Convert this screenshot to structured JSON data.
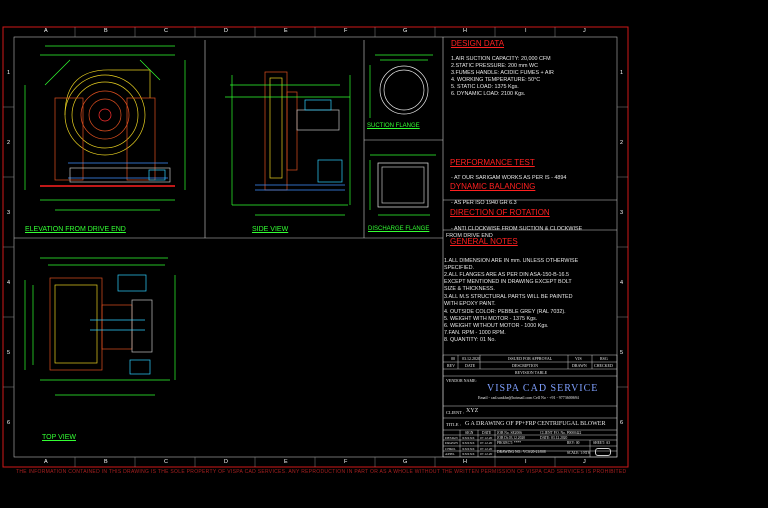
{
  "grid": {
    "columns": [
      "A",
      "B",
      "C",
      "D",
      "E",
      "F",
      "G",
      "H",
      "I",
      "J"
    ],
    "rows": [
      "1",
      "2",
      "3",
      "4",
      "5",
      "6"
    ]
  },
  "views": {
    "elevation_label": "ELEVATION FROM DRIVE END",
    "side_label": "SIDE VIEW",
    "suction_label": "SUCTION FLANGE",
    "discharge_label": "DISCHARGE FLANGE",
    "top_label": "TOP VIEW"
  },
  "design_data": {
    "heading": "DESIGN DATA",
    "lines": [
      "1.AIR SUCTION CAPACITY: 20,000 CFM",
      "2.STATIC PRESSURE: 200 mm WC",
      "3.FUMES HANDLE: ACIDIC FUMES + AIR",
      "4.   WORKING TEMPERATURE: 50°C",
      "5.   STATIC LOAD: 1375 Kgs.",
      "6.   DYNAMIC LOAD: 2100 Kgs."
    ]
  },
  "performance": {
    "heading": "PERFORMANCE TEST",
    "text": "- AT OUR SARIGAM WORKS AS PER IS - 4894"
  },
  "balancing": {
    "heading": "DYNAMIC BALANCING",
    "text": "- AS PER ISO 1940 GR 6.3"
  },
  "rotation": {
    "heading": "DIRECTION OF ROTATION",
    "text1": "- ANTI CLOCKWISE FROM SUCTION  & CLOCKWISE",
    "text2": "FROM DRIVE END"
  },
  "general_notes": {
    "heading": "GENERAL NOTES",
    "lines": [
      "1.ALL DIMENSION ARE IN mm. UNLESS OTHERWISE",
      "SPECIFIED.",
      "2.ALL FLANGES ARE AS PER DIN ASA-150-B-16.5",
      "EXCEPT MENTIONED IN DRAWING EXCEPT BOLT",
      "SIZE & THICKNESS.",
      "3.ALL M.S STRUCTURAL PARTS WILL BE PAINTED",
      "WITH EPOXY PAINT.",
      "4.   OUTSIDE COLOR: PEBBLE GREY (RAL 7032).",
      "5.   WEIGHT WITH MOTOR - 1375 Kgs.",
      "6.   WEIGHT WITHOUT MOTOR - 1000 Kgs.",
      "7.FAN. RPM -  1000 RPM.",
      "8.   QUANTITY: 01 No."
    ]
  },
  "revision_table": {
    "row1": [
      "00",
      "03.12.2020",
      "ISSUED FOR APPROVAL",
      "VJS",
      "RSG"
    ],
    "headers": [
      "REV",
      "DATE",
      "DESCRIPTION",
      "DRAWN",
      "CHECKED"
    ],
    "title": "REVISION TABLE"
  },
  "title_block": {
    "vendor_label": "VENDOR NAME:",
    "company": "VISPA CAD SERVICE",
    "contact": "Email - cad.sankhe@hotmail.com  Cell No - +91 - 9773600694",
    "client_label": "CLIENT :",
    "client": "XYZ",
    "title_label": "TITLE :",
    "title": "G A DRAWING OF PP+FRP CENTRIFUGAL BLOWER",
    "col_sign": "SIGN",
    "col_date": "DATE",
    "job_no": "JOB No. SE2006",
    "client_po": "CLIENT P.O. No. P0000422",
    "job_date": "JOB Dt.03.12.2020",
    "date": "DATE: 03.12.2020",
    "project": "PROJECT: ****",
    "drawing_no": "DRAWING NO.: VCS/20-21/008",
    "rev_label": "REV: 00",
    "sheet": "SHEET: A3",
    "scale": "SCALE: 1:NTS",
    "roles": [
      {
        "role": "DESIGN",
        "sign": "XXXXX",
        "date": "07.12.20"
      },
      {
        "role": "DRAWN",
        "sign": "XXXXX",
        "date": "07.12.20"
      },
      {
        "role": "CHKD.",
        "sign": "XXXXX",
        "date": "07.12.20"
      },
      {
        "role": "APPD.",
        "sign": "XXXXX",
        "date": "07.12.20"
      }
    ]
  },
  "footer": "THE INFORMATION CONTAINED IN THIS DRAWING IS THE SOLE PROPERTY OF VISPA CAD SERVICES. ANY REPRODUCTION IN PART OR AS A WHOLE WITHOUT THE WRITTEN PERMISSION OF VISPA CAD SERVICES IS PROHIBITED."
}
